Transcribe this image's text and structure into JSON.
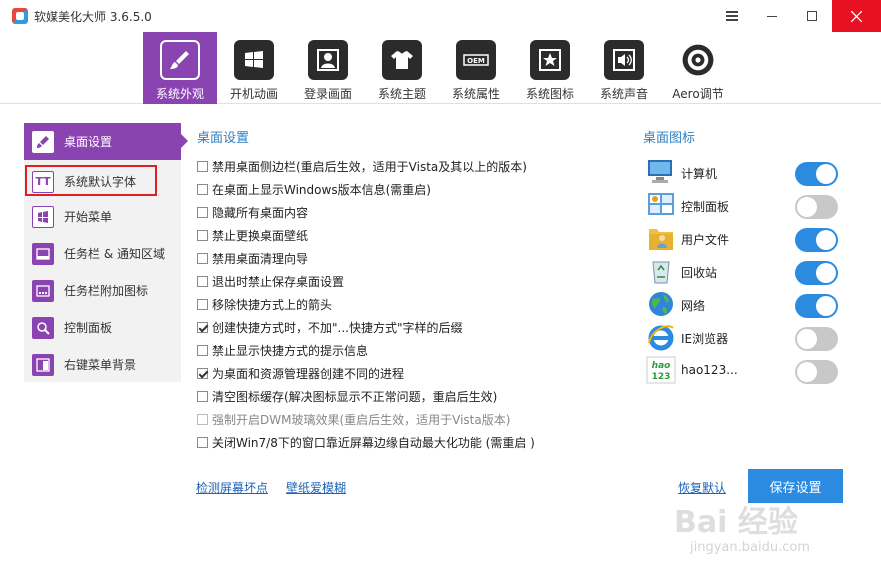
{
  "app": {
    "title": "软媒美化大师 3.6.5.0"
  },
  "topnav": [
    {
      "label": "系统外观",
      "icon": "brush-icon",
      "active": true
    },
    {
      "label": "开机动画",
      "icon": "windows-logo-icon"
    },
    {
      "label": "登录画面",
      "icon": "user-icon"
    },
    {
      "label": "系统主题",
      "icon": "tshirt-icon"
    },
    {
      "label": "系统属性",
      "icon": "oem-icon"
    },
    {
      "label": "系统图标",
      "icon": "star-icon"
    },
    {
      "label": "系统声音",
      "icon": "speaker-icon"
    },
    {
      "label": "Aero调节",
      "icon": "aero-icon"
    }
  ],
  "sidebar": [
    {
      "label": "桌面设置",
      "icon": "brush-icon",
      "active": true
    },
    {
      "label": "系统默认字体",
      "icon": "font-icon",
      "glyph": "TT"
    },
    {
      "label": "开始菜单",
      "icon": "start-menu-icon"
    },
    {
      "label": "任务栏 & 通知区域",
      "icon": "taskbar-icon"
    },
    {
      "label": "任务栏附加图标",
      "icon": "taskbar-icons-icon"
    },
    {
      "label": "控制面板",
      "icon": "search-panel-icon"
    },
    {
      "label": "右键菜单背景",
      "icon": "context-menu-icon"
    }
  ],
  "desktop_settings": {
    "title": "桌面设置",
    "options": [
      {
        "label": "禁用桌面侧边栏(重启后生效，适用于Vista及其以上的版本)",
        "checked": false
      },
      {
        "label": "在桌面上显示Windows版本信息(需重启)",
        "checked": false
      },
      {
        "label": "隐藏所有桌面内容",
        "checked": false
      },
      {
        "label": "禁止更换桌面壁纸",
        "checked": false
      },
      {
        "label": "禁用桌面清理向导",
        "checked": false
      },
      {
        "label": "退出时禁止保存桌面设置",
        "checked": false
      },
      {
        "label": "移除快捷方式上的箭头",
        "checked": false
      },
      {
        "label": "创建快捷方式时，不加\"...快捷方式\"字样的后缀",
        "checked": true
      },
      {
        "label": "禁止显示快捷方式的提示信息",
        "checked": false
      },
      {
        "label": "为桌面和资源管理器创建不同的进程",
        "checked": true
      },
      {
        "label": "清空图标缓存(解决图标显示不正常问题，重启后生效)",
        "checked": false
      },
      {
        "label": "强制开启DWM玻璃效果(重启后生效，适用于Vista版本)",
        "checked": false,
        "disabled": true
      },
      {
        "label": "关闭Win7/8下的窗口靠近屏幕边缘自动最大化功能 (需重启 )",
        "checked": false
      }
    ]
  },
  "desktop_icons": {
    "title": "桌面图标",
    "items": [
      {
        "label": "计算机",
        "icon": "computer-icon",
        "on": true
      },
      {
        "label": "控制面板",
        "icon": "control-panel-icon",
        "on": false
      },
      {
        "label": "用户文件",
        "icon": "user-folder-icon",
        "on": true
      },
      {
        "label": "回收站",
        "icon": "recycle-bin-icon",
        "on": true
      },
      {
        "label": "网络",
        "icon": "network-globe-icon",
        "on": true
      },
      {
        "label": "IE浏览器",
        "icon": "ie-browser-icon",
        "on": false
      },
      {
        "label": "hao123...",
        "icon": "hao123-icon",
        "icon_text": "hao 123",
        "on": false
      }
    ]
  },
  "links": {
    "detect_pixels": "检测屏幕坏点",
    "wallpaper_love": "壁纸爱模糊",
    "restore_default": "恢复默认"
  },
  "buttons": {
    "save": "保存设置"
  },
  "watermark": {
    "main": "Bai 经验",
    "sub": "jingyan.baidu.com"
  },
  "colors": {
    "accent_purple": "#8a44b2",
    "accent_blue": "#2b8be0",
    "close_red": "#e81123",
    "highlight_red": "#e02020"
  }
}
